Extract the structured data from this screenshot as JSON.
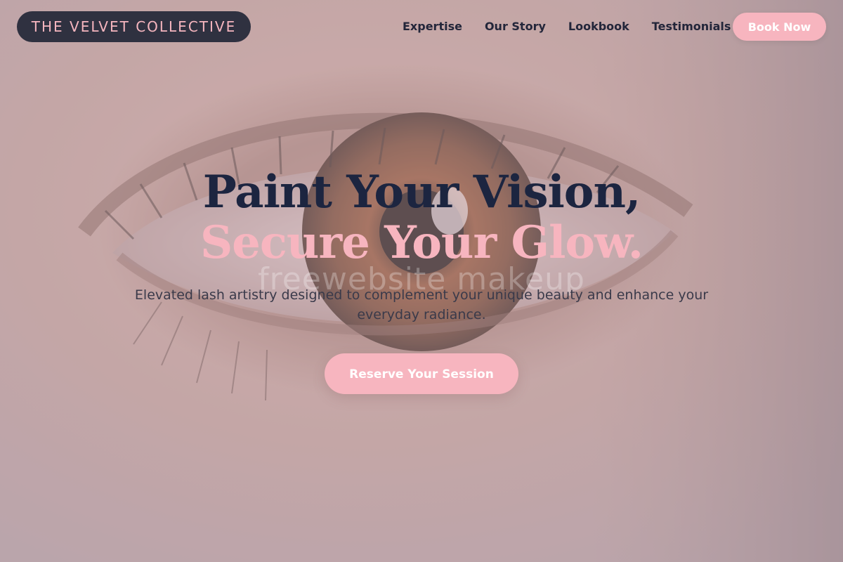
{
  "brand": {
    "name": "THE VELVET COLLECTIVE"
  },
  "nav": {
    "items": [
      {
        "label": "Expertise"
      },
      {
        "label": "Our Story"
      },
      {
        "label": "Lookbook"
      },
      {
        "label": "Testimonials"
      }
    ],
    "cta_label": "Book Now"
  },
  "hero": {
    "headline_line1": "Paint Your Vision,",
    "headline_line2": "Secure Your Glow.",
    "watermark": "freewebsite makeup",
    "subtitle": "Elevated lash artistry designed to complement your unique beauty and enhance your everyday radiance.",
    "cta_label": "Reserve Your Session",
    "background_image": "close-up-eye-photo"
  },
  "colors": {
    "accent_pink": "#f7b5bf",
    "navy": "#1c2540",
    "logo_pill_bg": "#2f3140"
  }
}
